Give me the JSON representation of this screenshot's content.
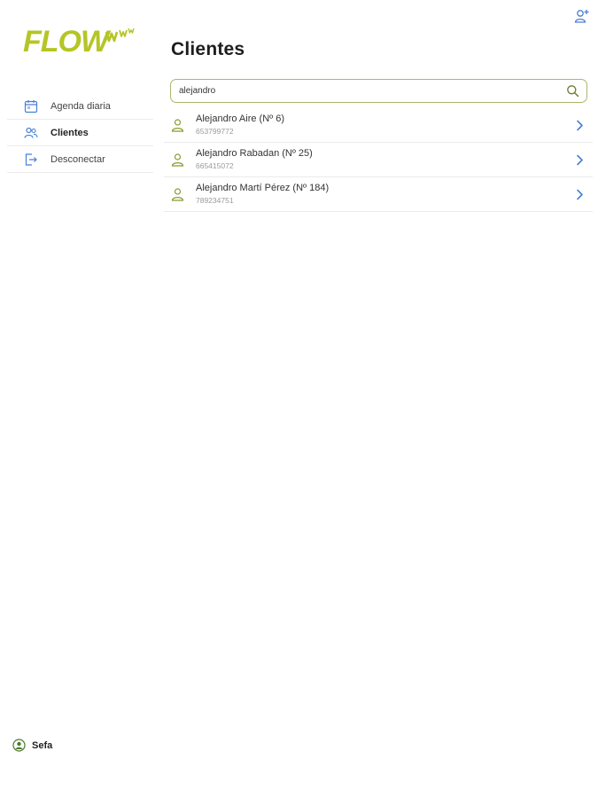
{
  "app": {
    "logo_text": "FLOW",
    "brand_color": "#b5c526",
    "accent_color": "#4a7fd4",
    "icon_green": "#8a9a2e"
  },
  "header": {
    "add_user_icon": "user-plus-icon"
  },
  "sidebar": {
    "items": [
      {
        "label": "Agenda diaria",
        "icon": "calendar-icon",
        "active": false
      },
      {
        "label": "Clientes",
        "icon": "users-icon",
        "active": true
      },
      {
        "label": "Desconectar",
        "icon": "logout-icon",
        "active": false
      }
    ],
    "user": {
      "name": "Sefa",
      "icon": "user-circle-icon"
    }
  },
  "main": {
    "title": "Clientes",
    "search": {
      "value": "alejandro",
      "placeholder": ""
    },
    "clients": [
      {
        "name": "Alejandro Aire (Nº 6)",
        "phone": "653799772"
      },
      {
        "name": "Alejandro Rabadan (Nº 25)",
        "phone": "665415072"
      },
      {
        "name": "Alejandro Martí Pérez (Nº 184)",
        "phone": "789234751"
      }
    ]
  }
}
